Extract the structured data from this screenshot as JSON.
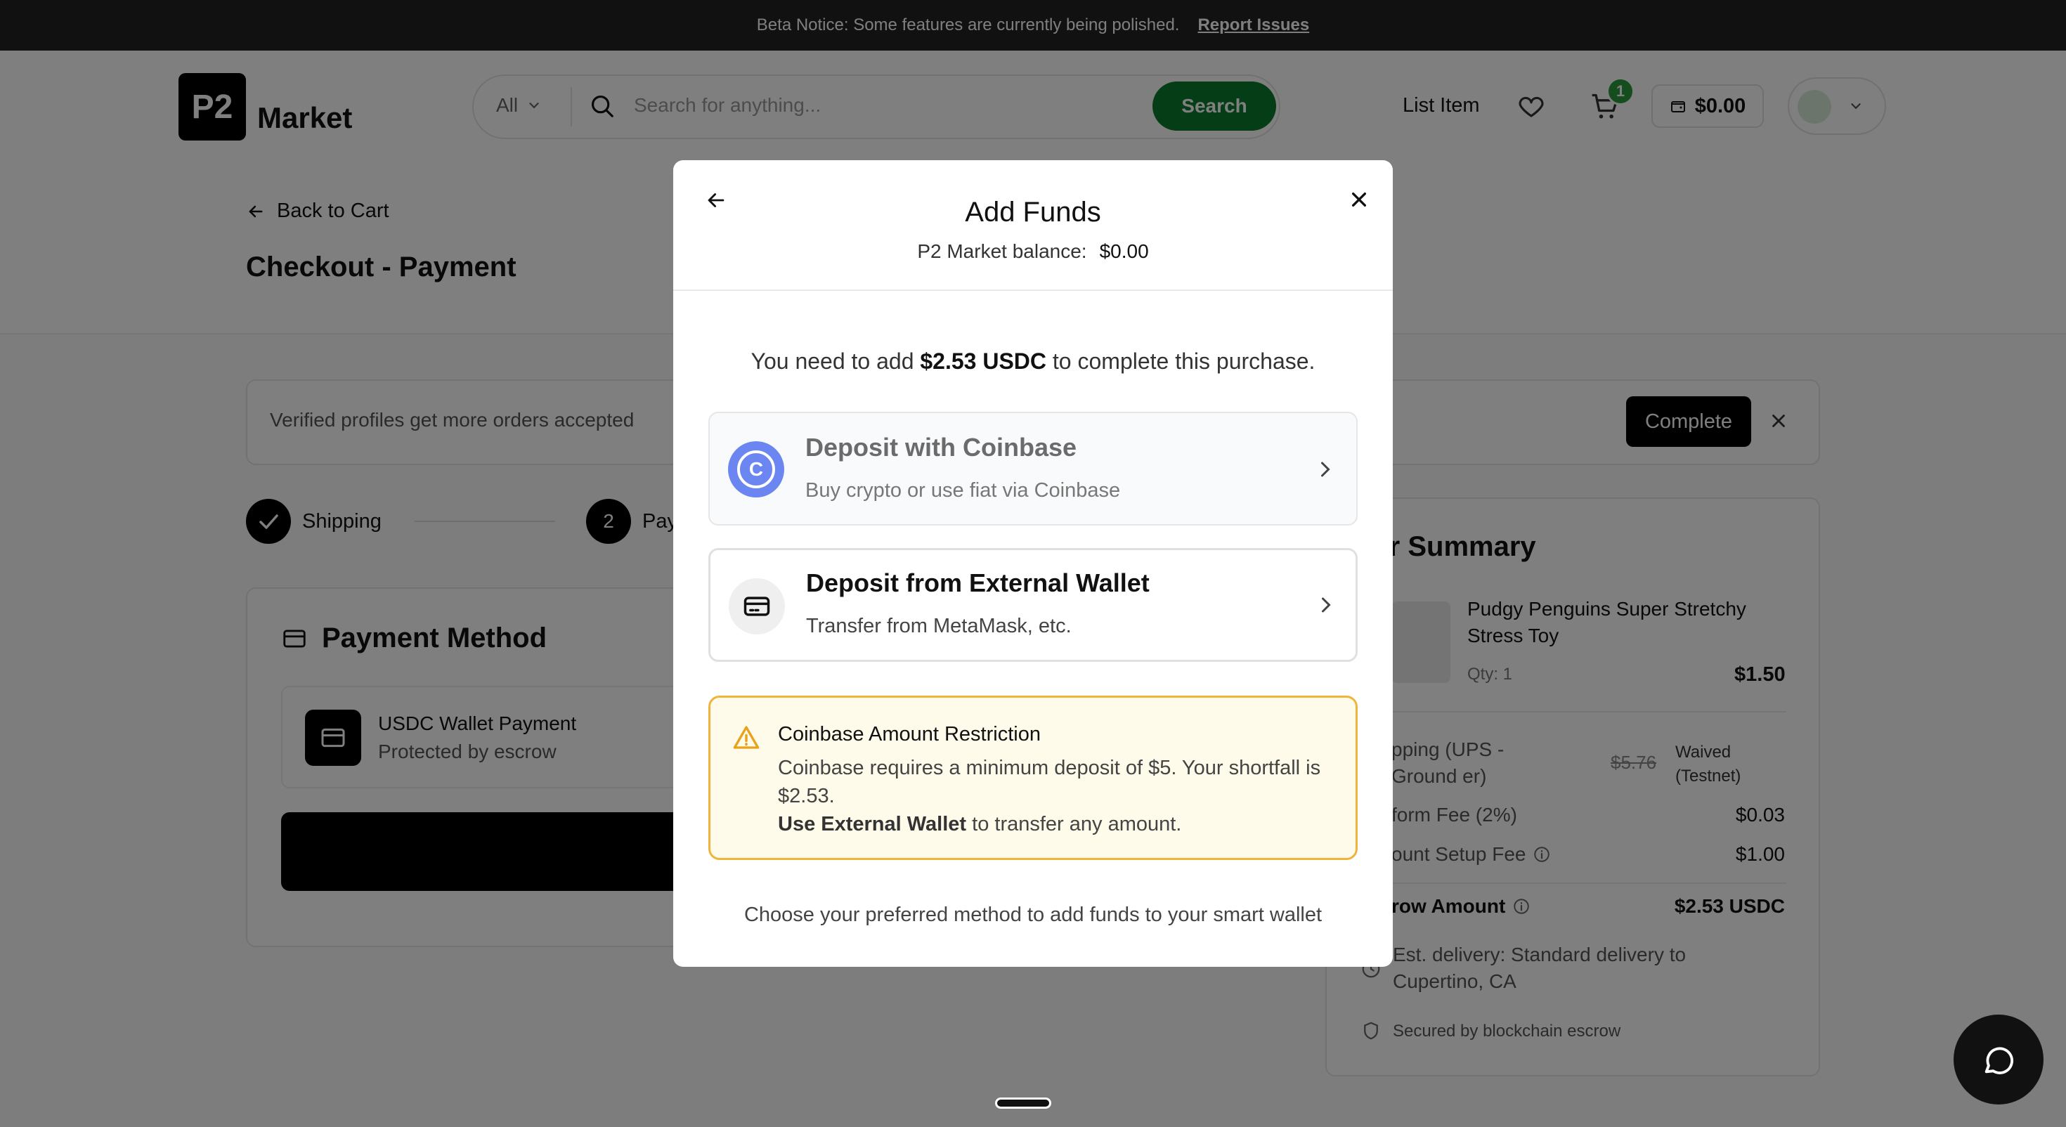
{
  "beta_bar": {
    "notice": "Beta Notice: Some features are currently being polished.",
    "link": "Report Issues"
  },
  "header": {
    "logo_mark": "P2",
    "logo_text": "Market",
    "search": {
      "category": "All",
      "placeholder": "Search for anything...",
      "button": "Search"
    },
    "list_item": "List Item",
    "cart_count": "1",
    "balance": "$0.00"
  },
  "page": {
    "back_label": "Back to Cart",
    "title": "Checkout - Payment",
    "verify_text": "Verified profiles get more orders accepted",
    "complete_button": "Complete",
    "steps": [
      {
        "label": "Shipping"
      },
      {
        "number": "2",
        "label": "Pay"
      }
    ],
    "payment": {
      "title": "Payment Method",
      "option_title": "USDC Wallet Payment",
      "option_sub": "Protected by escrow"
    }
  },
  "summary": {
    "title": "der Summary",
    "product_name": "Pudgy Penguins Super Stretchy Stress Toy",
    "qty": "Qty: 1",
    "price": "$1.50",
    "shipping_label": "pping (UPS - Ground er)",
    "shipping_strike": "$5.76",
    "shipping_waived": "Waived (Testnet)",
    "platform_fee_label": "form Fee (2%)",
    "platform_fee": "$0.03",
    "setup_fee_label": "ount Setup Fee",
    "setup_fee": "$1.00",
    "escrow_label": "row Amount",
    "escrow_amount": "$2.53 USDC",
    "delivery": "Est. delivery: Standard delivery to Cupertino, CA",
    "secured": "Secured by blockchain escrow"
  },
  "modal": {
    "title": "Add Funds",
    "balance_label": "P2 Market balance:",
    "balance_value": "$0.00",
    "need_prefix": "You need to add",
    "need_amount": "$2.53 USDC",
    "need_suffix": "to complete this purchase.",
    "options": [
      {
        "title": "Deposit with Coinbase",
        "subtitle": "Buy crypto or use fiat via Coinbase",
        "icon": "C"
      },
      {
        "title": "Deposit from External Wallet",
        "subtitle": "Transfer from MetaMask, etc."
      }
    ],
    "warning": {
      "title": "Coinbase Amount Restriction",
      "body": "Coinbase requires a minimum deposit of $5. Your shortfall is $2.53.",
      "bold": "Use External Wallet",
      "body_suffix": "to transfer any amount."
    },
    "footer": "Choose your preferred method to add funds to your smart wallet"
  },
  "colors": {
    "brand_green": "#0b7a2e",
    "coinbase_blue": "#6b86f0",
    "warning_border": "#f0b43c",
    "warning_bg": "#fefbea"
  }
}
